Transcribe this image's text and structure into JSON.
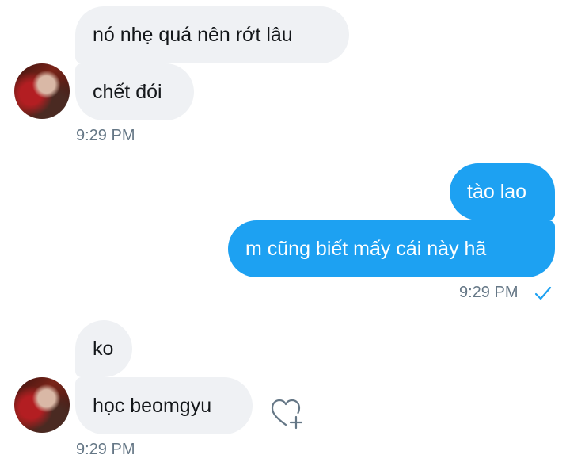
{
  "conversation": {
    "group1": {
      "messages": [
        "nó nhẹ quá nên rớt lâu",
        "chết đói"
      ],
      "time": "9:29 PM"
    },
    "group2": {
      "messages": [
        "tào lao",
        "m cũng biết mấy cái này hã"
      ],
      "time": "9:29 PM"
    },
    "group3": {
      "messages": [
        "ko",
        "học beomgyu"
      ],
      "time": "9:29 PM"
    }
  },
  "colors": {
    "sent_bubble": "#1da1f2",
    "received_bubble": "#eff1f4",
    "timestamp": "#657786"
  },
  "icons": {
    "avatar": "user-avatar",
    "read_receipt": "check-icon",
    "react": "heart-plus-icon"
  }
}
